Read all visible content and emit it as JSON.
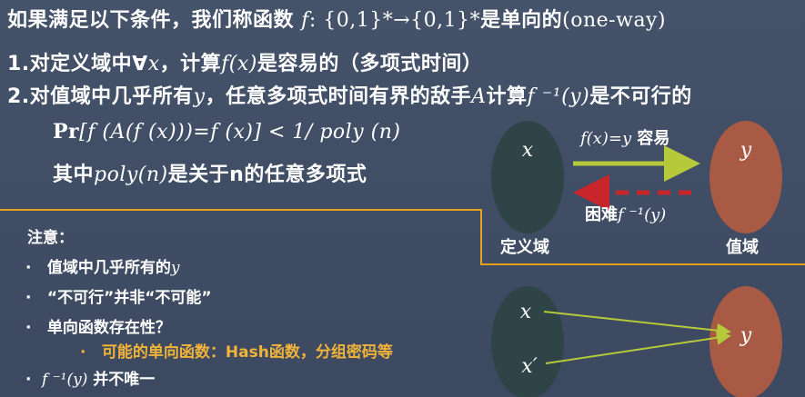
{
  "title": {
    "prefix": "如果满足以下条件，我们称函数 ",
    "f": "f",
    "sig": ": {0,1}*→{0,1}*",
    "suffix": "是单向的",
    "oneway": "(one-way)"
  },
  "cond1": {
    "prefix": "1.对定义域中∀",
    "x": "x",
    "mid": "，计算",
    "fx": "f(x)",
    "suffix": "是容易的（多项式时间）"
  },
  "cond2": {
    "prefix": "2.对值域中几乎所有",
    "y": "y",
    "mid": "，任意多项式时间有界的敌手",
    "A": "A",
    "calc": "计算",
    "finv": "f ⁻¹(y)",
    "suffix": "是不可行的"
  },
  "formula": {
    "pr": "Pr",
    "body": "[f (A(f (x)))=f (x)] < 1/ poly (n)"
  },
  "poly_note": {
    "prefix": "其中",
    "poly": "poly(n)",
    "suffix": "是关于n的任意多项式"
  },
  "notes": {
    "heading": "注意：",
    "items": [
      {
        "bullet": "·",
        "text": " 值域中几乎所有的",
        "var": "y"
      },
      {
        "bullet": "·",
        "text": " “不可行”并非“不可能”"
      },
      {
        "bullet": "·",
        "text": " 单向函数存在性？"
      },
      {
        "bullet": "·",
        "text": " 可能的单向函数：Hash函数，分组密码等"
      },
      {
        "bullet": "·",
        "text": " 并不唯一",
        "var": "f ⁻¹(y)"
      }
    ]
  },
  "diagram_top": {
    "domain_var": "x",
    "range_var": "y",
    "forward_label_math": "f(x)=y",
    "forward_label_text": " 容易",
    "backward_label_text": "困难",
    "backward_label_math": "f ⁻¹(y)",
    "domain_label": "定义域",
    "range_label": "值域"
  },
  "diagram_bottom": {
    "x1": "x",
    "x2": "x′",
    "y": "y"
  },
  "colors": {
    "background": "#3f4c63",
    "domain_oval": "#2e4447",
    "range_oval": "#a85a44",
    "forward_arrow": "#b6c93a",
    "backward_arrow": "#c8262a",
    "frame": "#e3a21a",
    "highlight_text": "#f0b43a"
  },
  "icons": {
    "forward": "arrow-right-icon",
    "backward": "arrow-left-dashed-icon"
  }
}
